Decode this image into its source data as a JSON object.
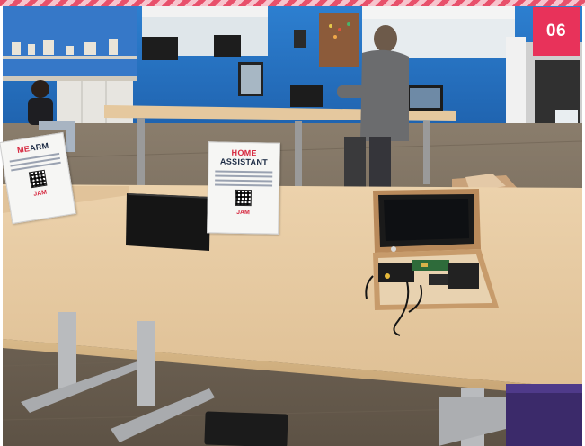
{
  "badge": {
    "number": "06"
  },
  "signs": {
    "left": {
      "title_accent": "ME",
      "title_rest": "ARM",
      "logo": "JAM"
    },
    "middle": {
      "title_accent": "HOME",
      "title_rest": " ASSISTANT",
      "logo": "JAM"
    }
  }
}
